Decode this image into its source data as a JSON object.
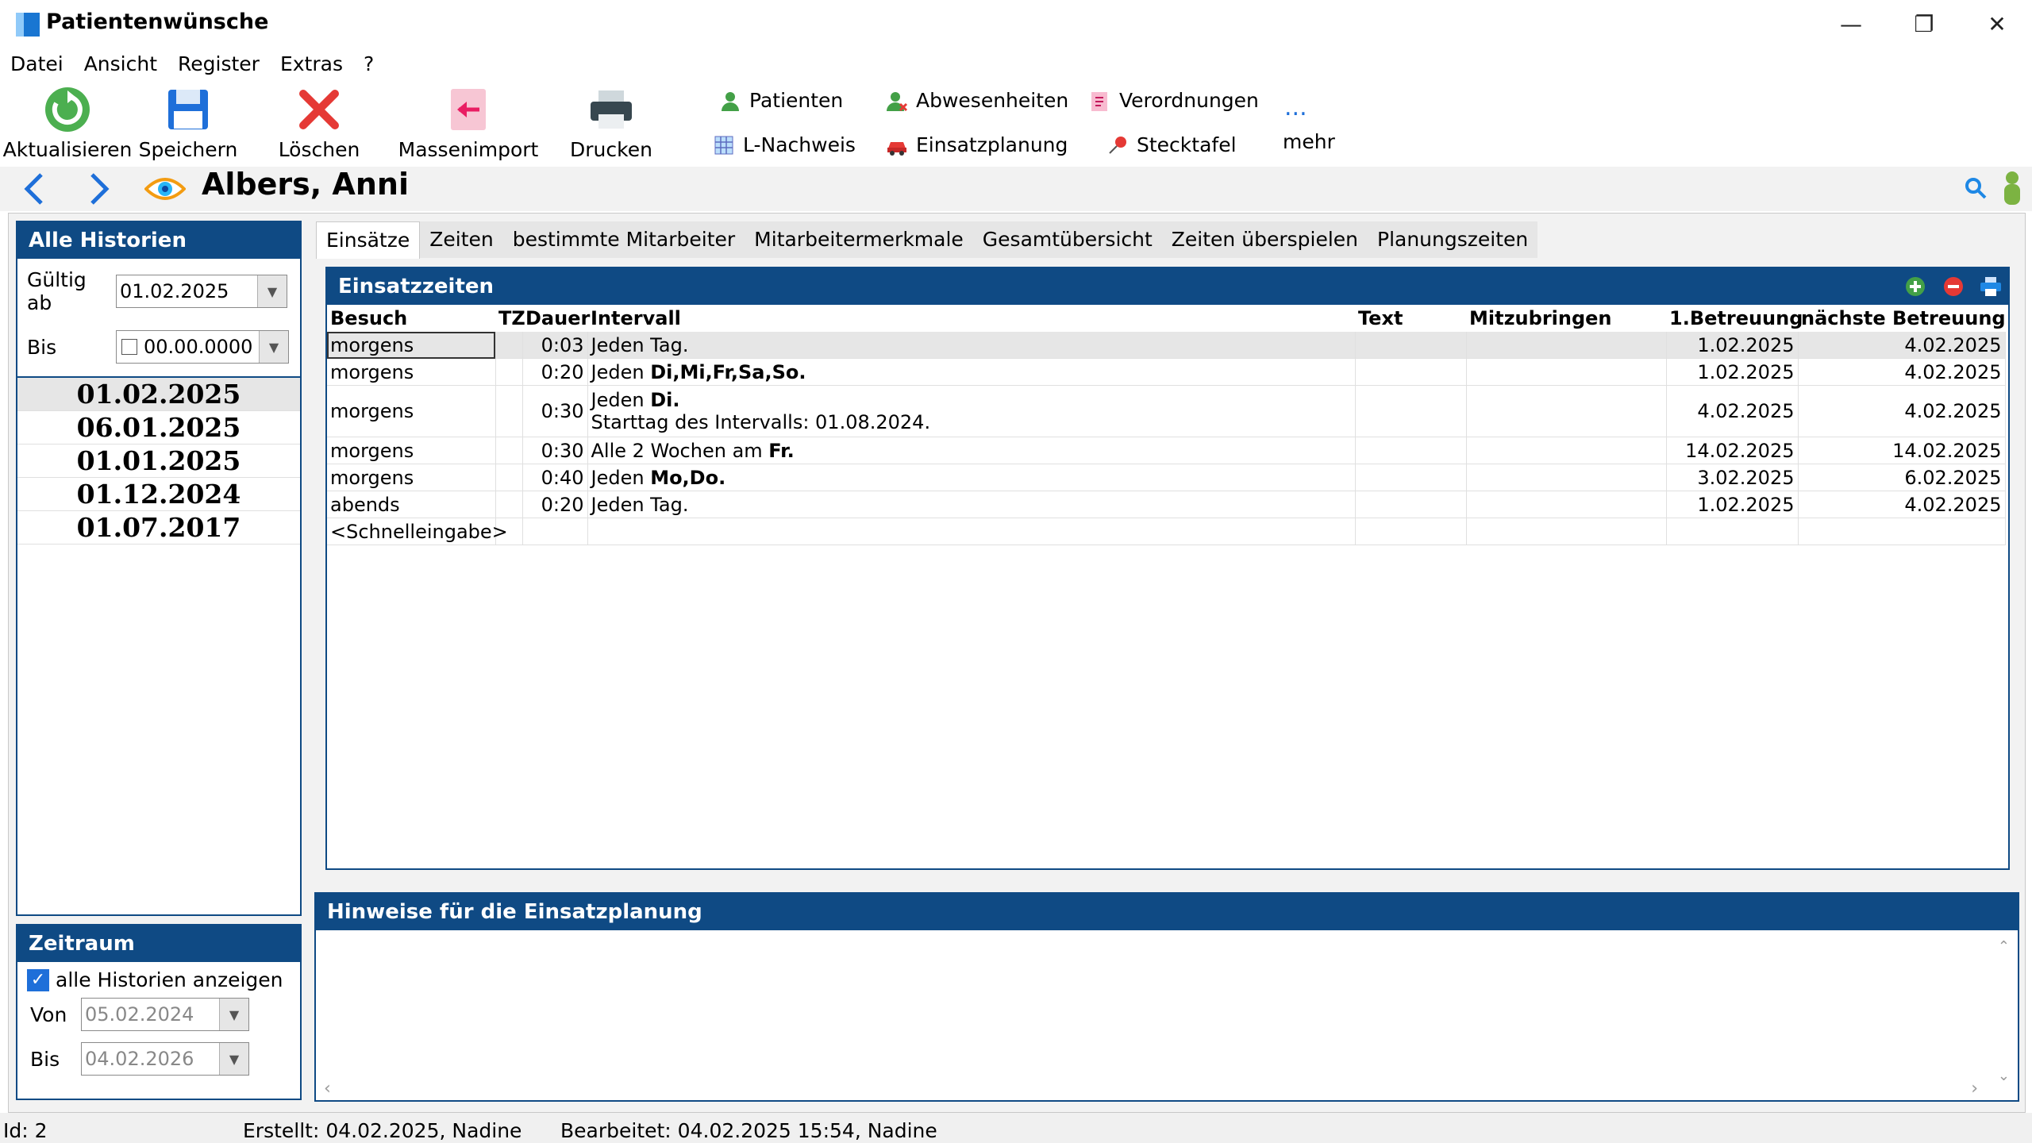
{
  "window": {
    "title": "Patientenwünsche",
    "controls": [
      "minimize",
      "restore",
      "close"
    ]
  },
  "menu": [
    "Datei",
    "Ansicht",
    "Register",
    "Extras",
    "?"
  ],
  "toolbar": {
    "refresh": "Aktualisieren",
    "save": "Speichern",
    "delete": "Löschen",
    "mass_import": "Massenimport",
    "print": "Drucken",
    "patients": "Patienten",
    "absences": "Abwesenheiten",
    "prescriptions": "Verordnungen",
    "l_nachweis": "L-Nachweis",
    "einsatzplanung": "Einsatzplanung",
    "stecktafel": "Stecktafel",
    "more": "mehr",
    "more_dots": "..."
  },
  "patient": {
    "name": "Albers, Anni"
  },
  "history": {
    "title": "Alle Historien",
    "valid_from_label": "Gültig ab",
    "valid_from": "01.02.2025",
    "until_label": "Bis",
    "until": "00.00.0000",
    "dates": [
      "01.02.2025",
      "06.01.2025",
      "01.01.2025",
      "01.12.2024",
      "01.07.2017"
    ]
  },
  "zeitraum": {
    "title": "Zeitraum",
    "show_all_label": "alle Historien anzeigen",
    "from_label": "Von",
    "from": "05.02.2024",
    "to_label": "Bis",
    "to": "04.02.2026"
  },
  "tabs": [
    "Einsätze",
    "Zeiten",
    "bestimmte Mitarbeiter",
    "Mitarbeitermerkmale",
    "Gesamtübersicht",
    "Zeiten überspielen",
    "Planungszeiten"
  ],
  "einsatzzeiten": {
    "title": "Einsatzzeiten",
    "columns": [
      "Besuch",
      "TZ",
      "Dauer",
      "Intervall",
      "Text",
      "Mitzubringen",
      "1.Betreuung",
      "nächste Betreuung"
    ],
    "rows": [
      {
        "besuch": "morgens",
        "tz": "",
        "dauer": "0:03",
        "int_a": "Jeden Tag.",
        "int_b": "",
        "int_c": "",
        "int_d": "",
        "text": "",
        "mitzubringen": "",
        "first": "1.02.2025",
        "next": "4.02.2025"
      },
      {
        "besuch": "morgens",
        "tz": "",
        "dauer": "0:20",
        "int_a": "Jeden ",
        "int_b": "Di,Mi,Fr,Sa,So",
        "int_c": ".",
        "int_d": "",
        "text": "",
        "mitzubringen": "",
        "first": "1.02.2025",
        "next": "4.02.2025"
      },
      {
        "besuch": "morgens",
        "tz": "",
        "dauer": "0:30",
        "int_a": "Jeden ",
        "int_b": "Di",
        "int_c": ".",
        "int_d": "Starttag des Intervalls: 01.08.2024.",
        "text": "",
        "mitzubringen": "",
        "first": "4.02.2025",
        "next": "4.02.2025"
      },
      {
        "besuch": "morgens",
        "tz": "",
        "dauer": "0:30",
        "int_a": "Alle 2 Wochen am ",
        "int_b": "Fr",
        "int_c": ".",
        "int_d": "",
        "text": "",
        "mitzubringen": "",
        "first": "14.02.2025",
        "next": "14.02.2025"
      },
      {
        "besuch": "morgens",
        "tz": "",
        "dauer": "0:40",
        "int_a": "Jeden ",
        "int_b": "Mo,Do",
        "int_c": ".",
        "int_d": "",
        "text": "",
        "mitzubringen": "",
        "first": "3.02.2025",
        "next": "6.02.2025"
      },
      {
        "besuch": "abends",
        "tz": "",
        "dauer": "0:20",
        "int_a": "Jeden Tag.",
        "int_b": "",
        "int_c": "",
        "int_d": "",
        "text": "",
        "mitzubringen": "",
        "first": "1.02.2025",
        "next": "4.02.2025"
      }
    ],
    "quick_entry": "<Schnelleingabe>"
  },
  "hints": {
    "title": "Hinweise für die Einsatzplanung"
  },
  "status": {
    "id": "Id: 2",
    "created": "Erstellt: 04.02.2025, Nadine",
    "edited": "Bearbeitet: 04.02.2025 15:54, Nadine"
  },
  "colors": {
    "panel_header": "#0f4a84",
    "accent_green": "#4caf50",
    "delete_red": "#e53935",
    "nav_blue": "#1e6fd9"
  }
}
